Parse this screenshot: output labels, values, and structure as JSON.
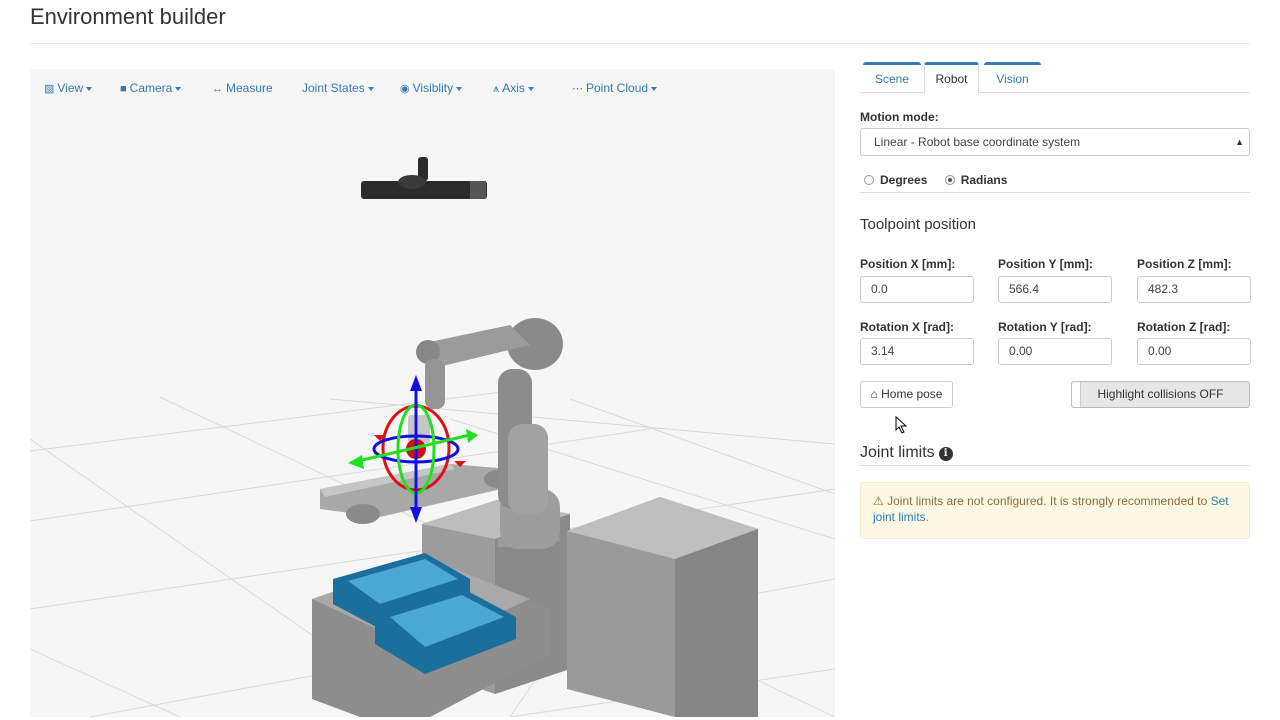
{
  "page": {
    "title": "Environment builder"
  },
  "toolbar": {
    "items": [
      {
        "label": "View",
        "icon": "cube-icon",
        "dropdown": true
      },
      {
        "label": "Camera",
        "icon": "video-camera-icon",
        "dropdown": true
      },
      {
        "label": "Measure",
        "icon": "arrows-h-icon",
        "dropdown": false
      },
      {
        "label": "Joint States",
        "icon": "",
        "dropdown": true
      },
      {
        "label": "Visiblity",
        "icon": "eye-icon",
        "dropdown": true
      },
      {
        "label": "Axis",
        "icon": "axis-icon",
        "dropdown": true
      },
      {
        "label": "Point Cloud",
        "icon": "ellipsis-icon",
        "dropdown": true
      }
    ]
  },
  "tabs": [
    {
      "label": "Scene",
      "active": false
    },
    {
      "label": "Robot",
      "active": true
    },
    {
      "label": "Vision",
      "active": false
    }
  ],
  "robot": {
    "motion_mode_label": "Motion mode:",
    "motion_mode_value": "Linear - Robot base coordinate system",
    "units": [
      {
        "label": "Degrees",
        "selected": false
      },
      {
        "label": "Radians",
        "selected": true
      }
    ],
    "toolpoint_title": "Toolpoint position",
    "fields": [
      {
        "label": "Position X [mm]:",
        "value": "0.0"
      },
      {
        "label": "Position Y [mm]:",
        "value": "566.4"
      },
      {
        "label": "Position Z [mm]:",
        "value": "482.3"
      },
      {
        "label": "Rotation X [rad]:",
        "value": "3.14"
      },
      {
        "label": "Rotation Y [rad]:",
        "value": "0.00"
      },
      {
        "label": "Rotation Z [rad]:",
        "value": "0.00"
      }
    ],
    "home_button": "Home pose",
    "collision_toggle": "Highlight collisions OFF",
    "joint_limits_title": "Joint limits",
    "alert_text": "Joint limits are not configured. It is strongly recommended to",
    "alert_link": "Set joint limits",
    "alert_period": "."
  },
  "colors": {
    "link": "#337ab7",
    "alert_bg": "#fcf8e3",
    "alert_text": "#8a6d3b",
    "bin_blue": "#1a6f9c",
    "gizmo_red": "#e01010",
    "gizmo_green": "#20e020",
    "gizmo_blue": "#1010e0"
  }
}
